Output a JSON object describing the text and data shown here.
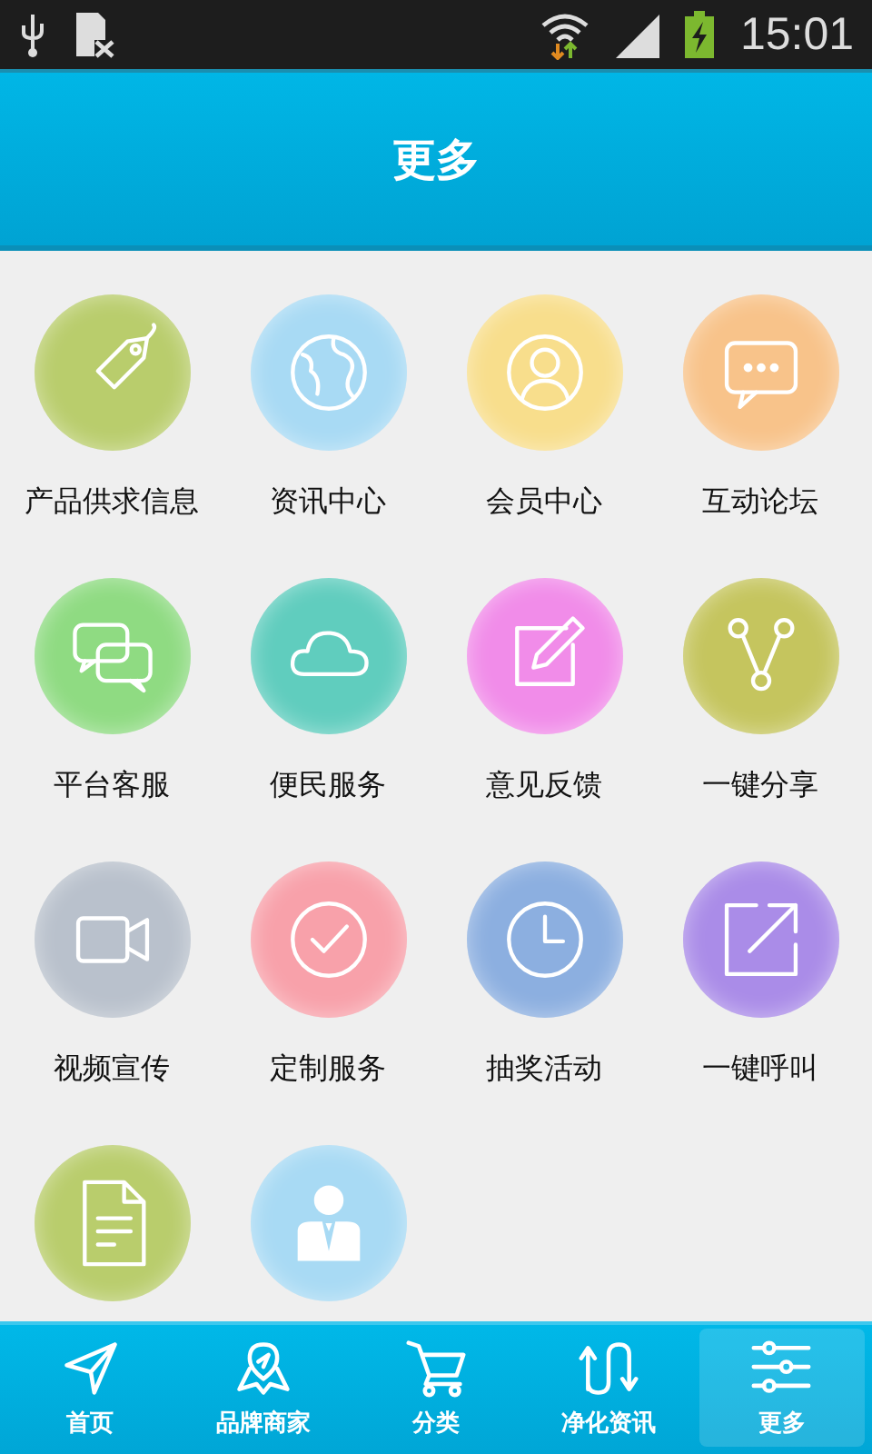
{
  "status_bar": {
    "time": "15:01"
  },
  "header": {
    "title": "更多"
  },
  "features": [
    {
      "label": "产品供求信息",
      "kind": "tag",
      "color": "#b9cd6c"
    },
    {
      "label": "资讯中心",
      "kind": "globe",
      "color": "#a8daf4"
    },
    {
      "label": "会员中心",
      "kind": "person",
      "color": "#f8de8c"
    },
    {
      "label": "互动论坛",
      "kind": "chat",
      "color": "#f8c38a"
    },
    {
      "label": "平台客服",
      "kind": "chats",
      "color": "#8fdb82"
    },
    {
      "label": "便民服务",
      "kind": "cloud",
      "color": "#60cdbe"
    },
    {
      "label": "意见反馈",
      "kind": "edit",
      "color": "#f18ce9"
    },
    {
      "label": "一键分享",
      "kind": "share",
      "color": "#c5c55e"
    },
    {
      "label": "视频宣传",
      "kind": "video",
      "color": "#b9c1cc"
    },
    {
      "label": "定制服务",
      "kind": "check",
      "color": "#f8a1aa"
    },
    {
      "label": "抽奖活动",
      "kind": "clock",
      "color": "#8cafe0"
    },
    {
      "label": "一键呼叫",
      "kind": "external",
      "color": "#aa8ce8"
    },
    {
      "kind": "document",
      "color": "#b9cd6c"
    },
    {
      "kind": "agent",
      "color": "#a8daf4"
    }
  ],
  "tabs": [
    {
      "label": "首页",
      "kind": "plane",
      "selected": false
    },
    {
      "label": "品牌商家",
      "kind": "map",
      "selected": false
    },
    {
      "label": "分类",
      "kind": "cart",
      "selected": false
    },
    {
      "label": "净化资讯",
      "kind": "uturn",
      "selected": false
    },
    {
      "label": "更多",
      "kind": "sliders",
      "selected": true
    }
  ]
}
